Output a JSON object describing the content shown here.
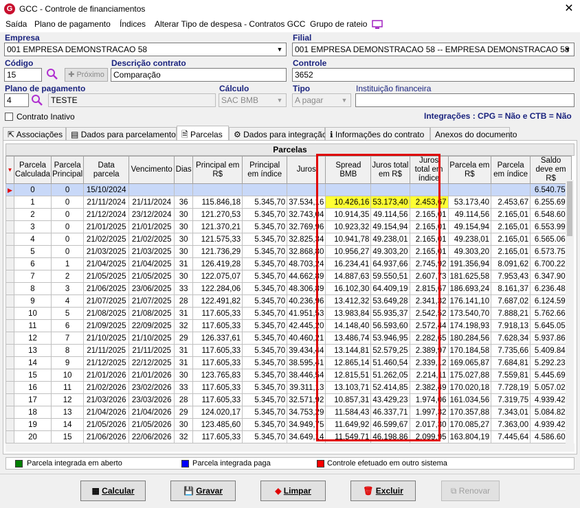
{
  "window": {
    "title": "GCC - Controle de financiamentos",
    "close": "✕"
  },
  "menu": [
    "Saída",
    "Plano de pagamento",
    "Índices",
    "Alterar Tipo de despesa - Contratos GCC",
    "Grupo de rateio"
  ],
  "form": {
    "empresa_label": "Empresa",
    "empresa_value": "001 EMPRESA DEMONSTRACAO 58",
    "filial_label": "Filial",
    "filial_value": "001 EMPRESA DEMONSTRACAO 58 -- EMPRESA DEMONSTRACAO 58",
    "codigo_label": "Código",
    "codigo_value": "15",
    "proximo_label": "Próximo",
    "descricao_label": "Descrição contrato",
    "descricao_value": "Comparação",
    "controle_label": "Controle",
    "controle_value": "3652",
    "plano_label": "Plano de pagamento",
    "plano_code": "4",
    "plano_value": "TESTE",
    "calculo_label": "Cálculo",
    "calculo_value": "SAC BMB",
    "tipo_label": "Tipo",
    "tipo_value": "A pagar",
    "instituicao_label": "Instituição financeira",
    "instituicao_value": "",
    "inativo_label": "Contrato Inativo",
    "integracoes": "Integrações : CPG = Não e CTB = Não"
  },
  "tabs": [
    "Associações",
    "Dados para parcelamento",
    "Parcelas",
    "Dados para integração",
    "Informações do contrato",
    "Anexos do documento"
  ],
  "grid": {
    "title": "Parcelas",
    "headers": [
      "Parcela Calculada",
      "Parcela Principal",
      "Data parcela",
      "Vencimento",
      "Dias",
      "Principal em R$",
      "Principal em índice",
      "Juros",
      "Spread BMB",
      "Juros total em R$",
      "Juros total em índice",
      "Parcela em R$",
      "Parcela em índice",
      "Saldo deve em R$"
    ],
    "rows": [
      [
        "0",
        "0",
        "15/10/2024",
        "",
        "",
        "",
        "",
        "",
        "",
        "",
        "",
        "",
        "",
        "6.540.750"
      ],
      [
        "1",
        "0",
        "21/11/2024",
        "21/11/2024",
        "36",
        "115.846,18",
        "5.345,70",
        "37.534,16",
        "10.426,16",
        "53.173,40",
        "2.453,67",
        "53.173,40",
        "2.453,67",
        "6.255.693"
      ],
      [
        "2",
        "0",
        "21/12/2024",
        "23/12/2024",
        "30",
        "121.270,53",
        "5.345,70",
        "32.743,04",
        "10.914,35",
        "49.114,56",
        "2.165,01",
        "49.114,56",
        "2.165,01",
        "6.548.608"
      ],
      [
        "3",
        "0",
        "21/01/2025",
        "21/01/2025",
        "30",
        "121.370,21",
        "5.345,70",
        "32.769,96",
        "10.923,32",
        "49.154,94",
        "2.165,01",
        "49.154,94",
        "2.165,01",
        "6.553.991"
      ],
      [
        "4",
        "0",
        "21/02/2025",
        "21/02/2025",
        "30",
        "121.575,33",
        "5.345,70",
        "32.825,34",
        "10.941,78",
        "49.238,01",
        "2.165,01",
        "49.238,01",
        "2.165,01",
        "6.565.067"
      ],
      [
        "5",
        "0",
        "21/03/2025",
        "21/03/2025",
        "30",
        "121.736,29",
        "5.345,70",
        "32.868,80",
        "10.956,27",
        "49.303,20",
        "2.165,01",
        "49.303,20",
        "2.165,01",
        "6.573.759"
      ],
      [
        "6",
        "1",
        "21/04/2025",
        "21/04/2025",
        "31",
        "126.419,28",
        "5.345,70",
        "48.703,24",
        "16.234,41",
        "64.937,66",
        "2.745,92",
        "191.356,94",
        "8.091,62",
        "6.700.221"
      ],
      [
        "7",
        "2",
        "21/05/2025",
        "21/05/2025",
        "30",
        "122.075,07",
        "5.345,70",
        "44.662,89",
        "14.887,63",
        "59.550,51",
        "2.607,73",
        "181.625,58",
        "7.953,43",
        "6.347.903"
      ],
      [
        "8",
        "3",
        "21/06/2025",
        "23/06/2025",
        "33",
        "122.284,06",
        "5.345,70",
        "48.306,89",
        "16.102,30",
        "64.409,19",
        "2.815,67",
        "186.693,24",
        "8.161,37",
        "6.236.486"
      ],
      [
        "9",
        "4",
        "21/07/2025",
        "21/07/2025",
        "28",
        "122.491,82",
        "5.345,70",
        "40.236,96",
        "13.412,32",
        "53.649,28",
        "2.341,32",
        "176.141,10",
        "7.687,02",
        "6.124.590"
      ],
      [
        "10",
        "5",
        "21/08/2025",
        "21/08/2025",
        "31",
        "117.605,33",
        "5.345,70",
        "41.951,53",
        "13.983,84",
        "55.935,37",
        "2.542,52",
        "173.540,70",
        "7.888,21",
        "5.762.661"
      ],
      [
        "11",
        "6",
        "21/09/2025",
        "22/09/2025",
        "32",
        "117.605,33",
        "5.345,70",
        "42.445,20",
        "14.148,40",
        "56.593,60",
        "2.572,44",
        "174.198,93",
        "7.918,13",
        "5.645.055"
      ],
      [
        "12",
        "7",
        "21/10/2025",
        "21/10/2025",
        "29",
        "126.337,61",
        "5.345,70",
        "40.460,21",
        "13.486,74",
        "53.946,95",
        "2.282,65",
        "180.284,56",
        "7.628,34",
        "5.937.867"
      ],
      [
        "13",
        "8",
        "21/11/2025",
        "21/11/2025",
        "31",
        "117.605,33",
        "5.345,70",
        "39.434,44",
        "13.144,81",
        "52.579,25",
        "2.389,97",
        "170.184,58",
        "7.735,66",
        "5.409.845"
      ],
      [
        "14",
        "9",
        "21/12/2025",
        "22/12/2025",
        "31",
        "117.605,33",
        "5.345,70",
        "38.595,41",
        "12.865,14",
        "51.460,54",
        "2.339,12",
        "169.065,87",
        "7.684,81",
        "5.292.239"
      ],
      [
        "15",
        "10",
        "21/01/2026",
        "21/01/2026",
        "30",
        "123.765,83",
        "5.345,70",
        "38.446,54",
        "12.815,51",
        "51.262,05",
        "2.214,11",
        "175.027,88",
        "7.559,81",
        "5.445.696"
      ],
      [
        "16",
        "11",
        "21/02/2026",
        "23/02/2026",
        "33",
        "117.605,33",
        "5.345,70",
        "39.311,13",
        "13.103,71",
        "52.414,85",
        "2.382,49",
        "170.020,18",
        "7.728,19",
        "5.057.029"
      ],
      [
        "17",
        "12",
        "21/03/2026",
        "23/03/2026",
        "28",
        "117.605,33",
        "5.345,70",
        "32.571,92",
        "10.857,31",
        "43.429,23",
        "1.974,06",
        "161.034,56",
        "7.319,75",
        "4.939.423"
      ],
      [
        "18",
        "13",
        "21/04/2026",
        "21/04/2026",
        "29",
        "124.020,17",
        "5.345,70",
        "34.753,29",
        "11.584,43",
        "46.337,71",
        "1.997,32",
        "170.357,88",
        "7.343,01",
        "5.084.826"
      ],
      [
        "19",
        "14",
        "21/05/2026",
        "21/05/2026",
        "30",
        "123.485,60",
        "5.345,70",
        "34.949,75",
        "11.649,92",
        "46.599,67",
        "2.017,30",
        "170.085,27",
        "7.363,00",
        "4.939.423"
      ],
      [
        "20",
        "15",
        "21/06/2026",
        "22/06/2026",
        "32",
        "117.605,33",
        "5.345,70",
        "34.649,14",
        "11.549,71",
        "46.198,86",
        "2.099,95",
        "163.804,19",
        "7.445,64",
        "4.586.607"
      ]
    ]
  },
  "legend": [
    "Parcela integrada em aberto",
    "Parcela integrada paga",
    "Controle efetuado em outro sistema"
  ],
  "colors": {
    "legend_green": "#008000",
    "legend_blue": "#0000ff",
    "legend_red": "#ff0000",
    "highlight_box": "#e00000",
    "highlight_cells": "#ffff33"
  },
  "buttons": [
    "Calcular",
    "Gravar",
    "Limpar",
    "Excluir",
    "Renovar"
  ]
}
